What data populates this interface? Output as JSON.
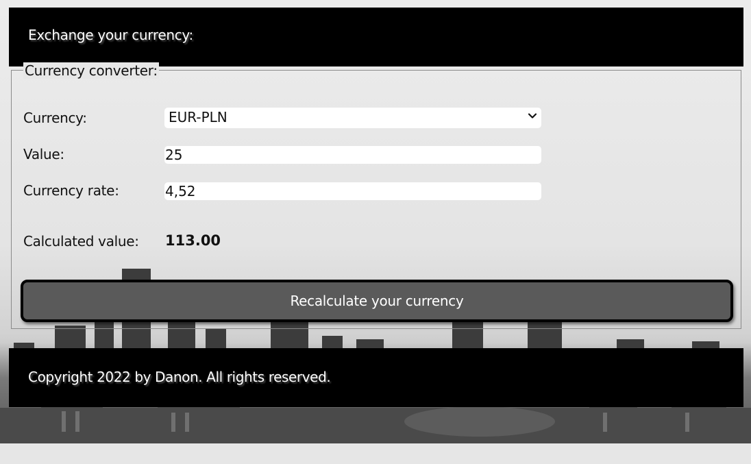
{
  "header": {
    "title": "Exchange your currency:"
  },
  "converter": {
    "legend": "Currency converter:",
    "currency_label": "Currency:",
    "currency_selected": "EUR-PLN",
    "value_label": "Value:",
    "value": "25",
    "rate_label": "Currency rate:",
    "rate": "4,52",
    "calculated_label": "Calculated value:",
    "calculated_value": "113.00",
    "button_label": "Recalculate your currency"
  },
  "footer": {
    "text": "Copyright 2022 by Danon. All rights reserved."
  },
  "colors": {
    "header_bg": "#000000",
    "button_bg": "#5a5a5a",
    "page_bg": "#e6e6e6"
  },
  "icons": {
    "select_chevron": "chevron-down-icon"
  }
}
